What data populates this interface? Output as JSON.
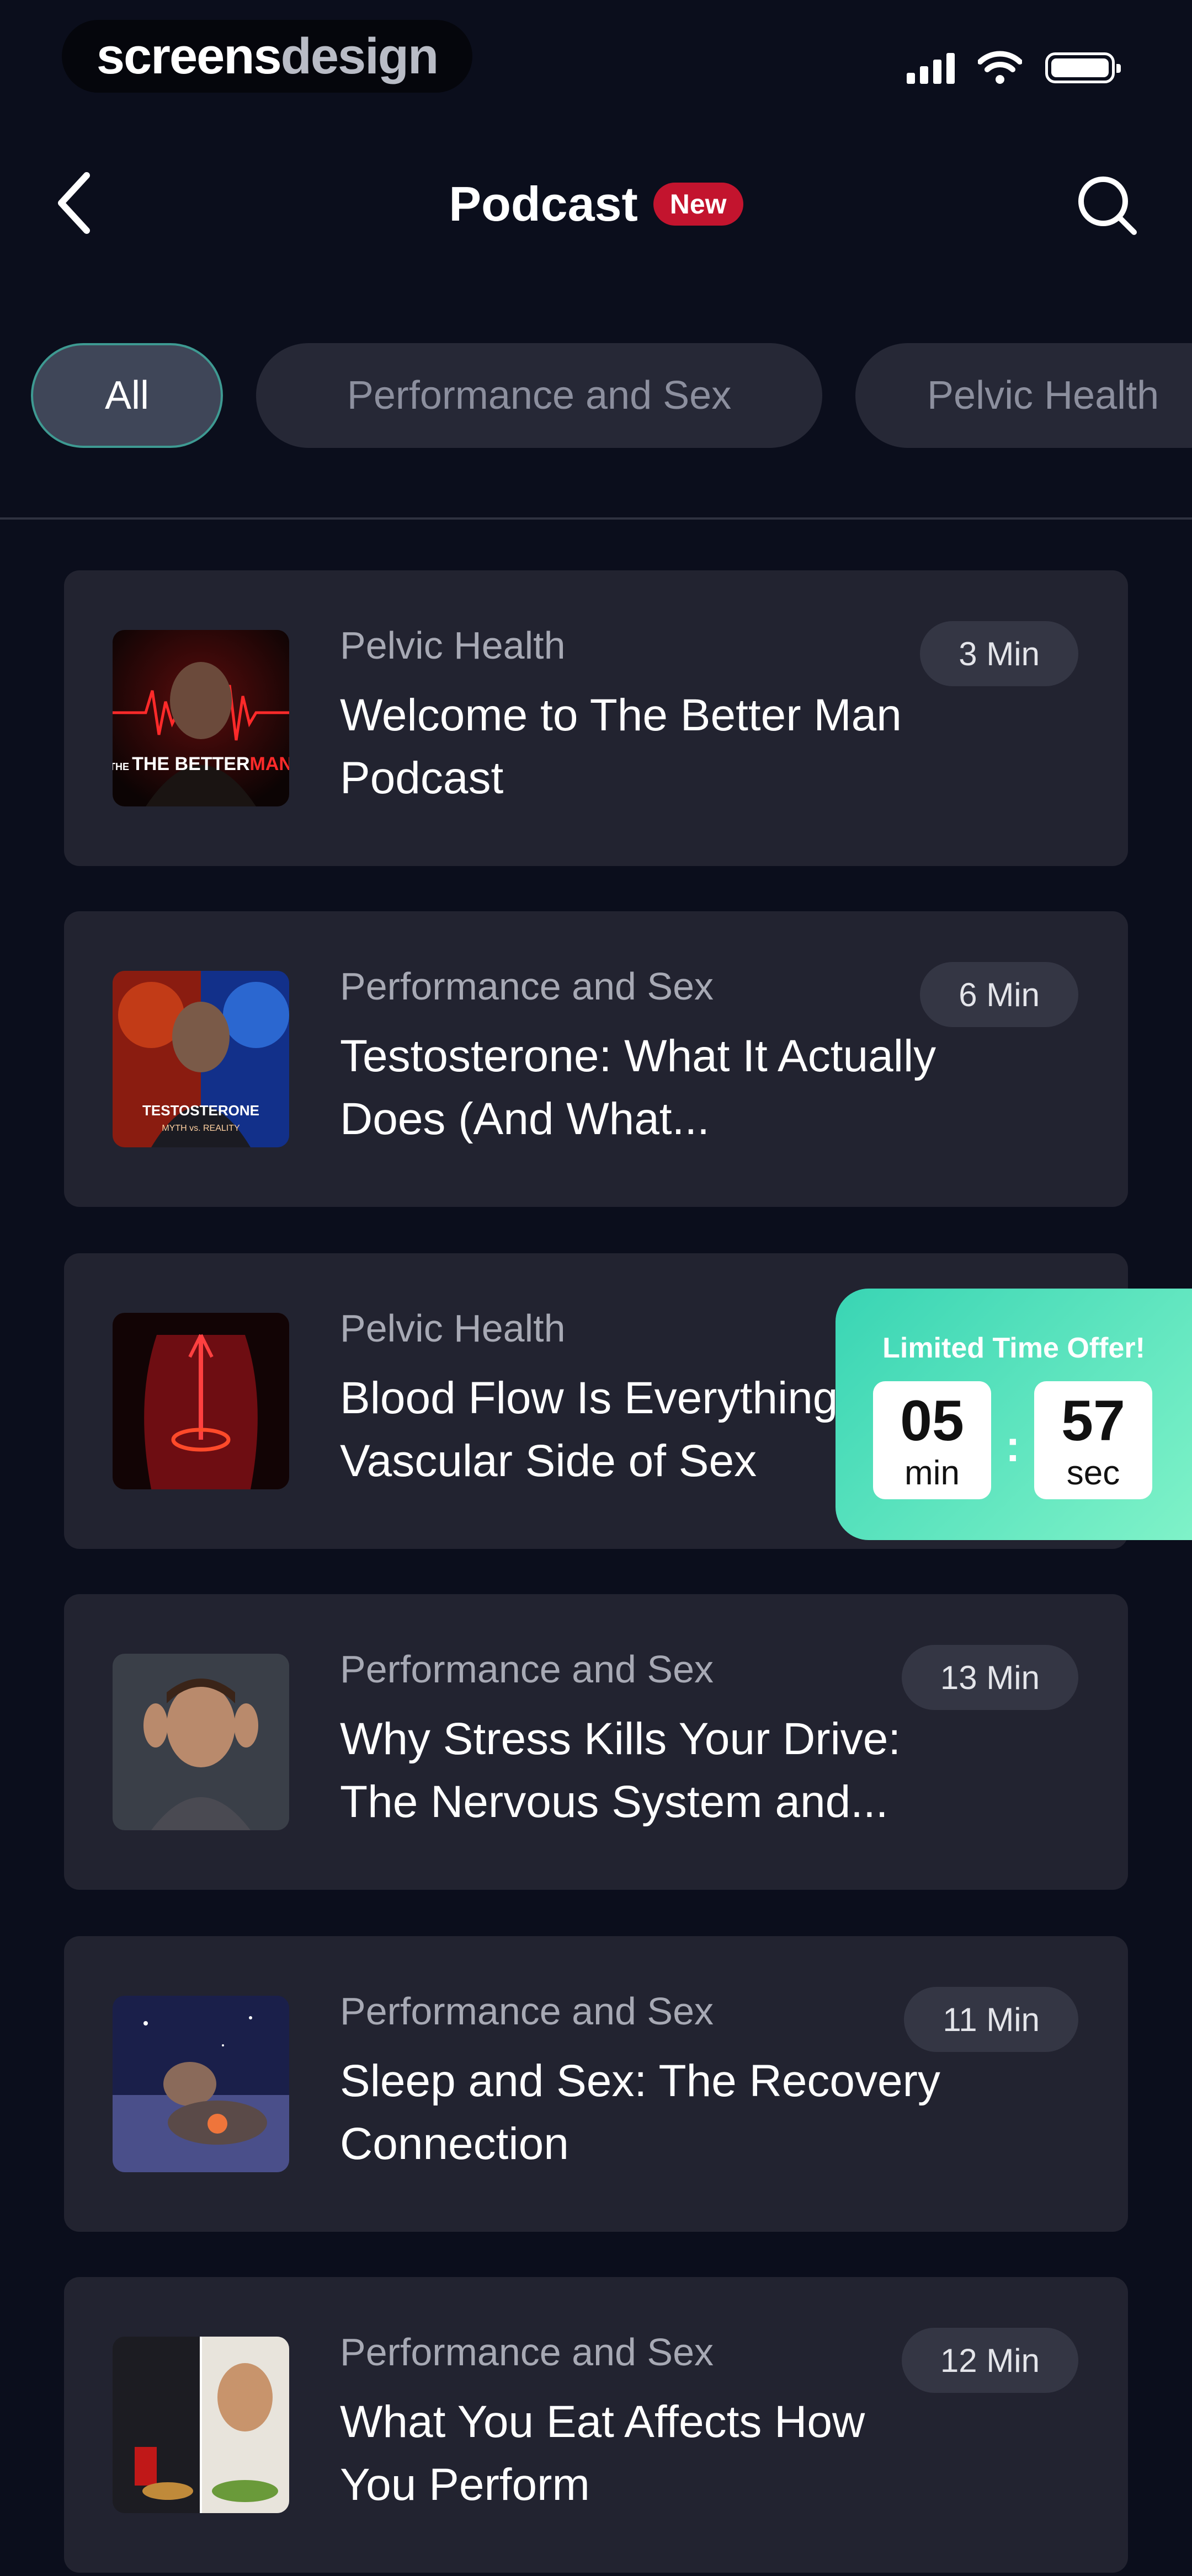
{
  "status_bar": {
    "watermark_part1": "screens",
    "watermark_part2": "design"
  },
  "header": {
    "title": "Podcast",
    "badge": "New"
  },
  "tabs": [
    {
      "label": "All",
      "active": true
    },
    {
      "label": "Performance and Sex",
      "active": false
    },
    {
      "label": "Pelvic Health",
      "active": false
    }
  ],
  "episodes": [
    {
      "category": "Pelvic Health",
      "title": "Welcome to The Better Man Podcast",
      "duration": "3 Min",
      "thumb_caption_1": "THE BETTER",
      "thumb_caption_2": "MAN"
    },
    {
      "category": "Performance and Sex",
      "title": "Testosterone: What It Actually Does (And What...",
      "duration": "6 Min",
      "thumb_caption_1": "TESTOSTERONE",
      "thumb_caption_2": "MYTH vs. REALITY"
    },
    {
      "category": "Pelvic Health",
      "title": "Blood Flow Is Everything: The Vascular Side of Sex",
      "duration": ""
    },
    {
      "category": "Performance and Sex",
      "title": "Why Stress Kills Your Drive: The Nervous System and...",
      "duration": "13 Min"
    },
    {
      "category": "Performance and Sex",
      "title": "Sleep and Sex: The Recovery Connection",
      "duration": "11 Min"
    },
    {
      "category": "Performance and Sex",
      "title": "What You Eat Affects How You Perform",
      "duration": "12 Min"
    }
  ],
  "offer": {
    "title": "Limited Time Offer!",
    "minutes": "05",
    "minutes_label": "min",
    "seconds": "57",
    "seconds_label": "sec",
    "separator": ":"
  },
  "colors": {
    "background": "#0b0e1c",
    "card": "#222330",
    "badge_red": "#c3142e",
    "tab_active_border": "#3e9a92",
    "offer_start": "#39d5b4",
    "offer_end": "#7ff2c8"
  }
}
